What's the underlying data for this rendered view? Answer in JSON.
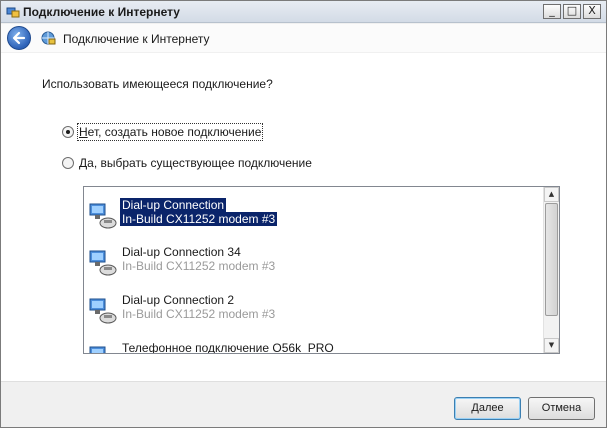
{
  "window": {
    "title": "Подключение к Интернету",
    "controls": {
      "minimize": "_",
      "maximize": "□",
      "close": "X"
    }
  },
  "nav": {
    "back_icon": "back-arrow-icon",
    "title": "Подключение к Интернету"
  },
  "main": {
    "question": "Использовать имеющееся подключение?",
    "options": [
      {
        "mnemonic": "Н",
        "rest": "ет, создать новое подключение",
        "checked": true
      },
      {
        "mnemonic": "Д",
        "rest": "а, выбрать существующее подключение",
        "checked": false
      }
    ],
    "connections": [
      {
        "name": "Dial-up Connection",
        "device": "In-Build CX11252 modem #3",
        "selected": true
      },
      {
        "name": "Dial-up Connection 34",
        "device": "In-Build CX11252 modem #3",
        "selected": false
      },
      {
        "name": "Dial-up Connection 2",
        "device": "In-Build CX11252 modem #3",
        "selected": false
      },
      {
        "name": "Телефонное подключение O56k_PRO",
        "device": "",
        "selected": false
      }
    ]
  },
  "footer": {
    "next": {
      "mnemonic": "Д",
      "rest": "алее"
    },
    "cancel": "Отмена"
  },
  "colors": {
    "selection": "#0a246a",
    "dim_text": "#9a9a9a"
  }
}
